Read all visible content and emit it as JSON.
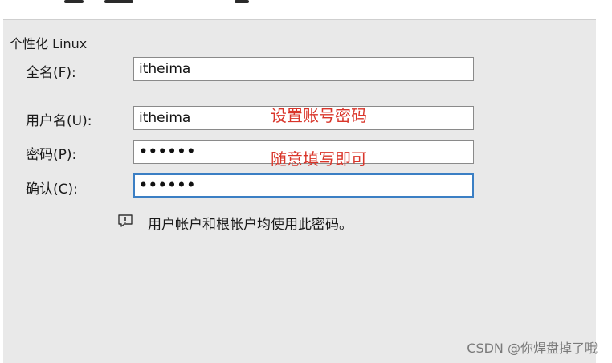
{
  "section": {
    "title": "个性化 Linux"
  },
  "fields": {
    "fullname": {
      "label": "全名(F):",
      "value": "itheima"
    },
    "username": {
      "label": "用户名(U):",
      "value": "itheima"
    },
    "password": {
      "label": "密码(P):",
      "value": "••••••"
    },
    "confirm": {
      "label": "确认(C):",
      "value": "••••••"
    }
  },
  "annotations": {
    "set_account": "设置账号密码",
    "fill_any": "随意填写即可"
  },
  "info": {
    "text": "用户帐户和根帐户均使用此密码。",
    "icon": "info-icon"
  },
  "watermark": {
    "text": "CSDN @你焊盘掉了哦"
  },
  "colors": {
    "annotation": "#d9352a",
    "focus_border": "#3b7fc4",
    "panel_bg": "#e9e9e9"
  }
}
